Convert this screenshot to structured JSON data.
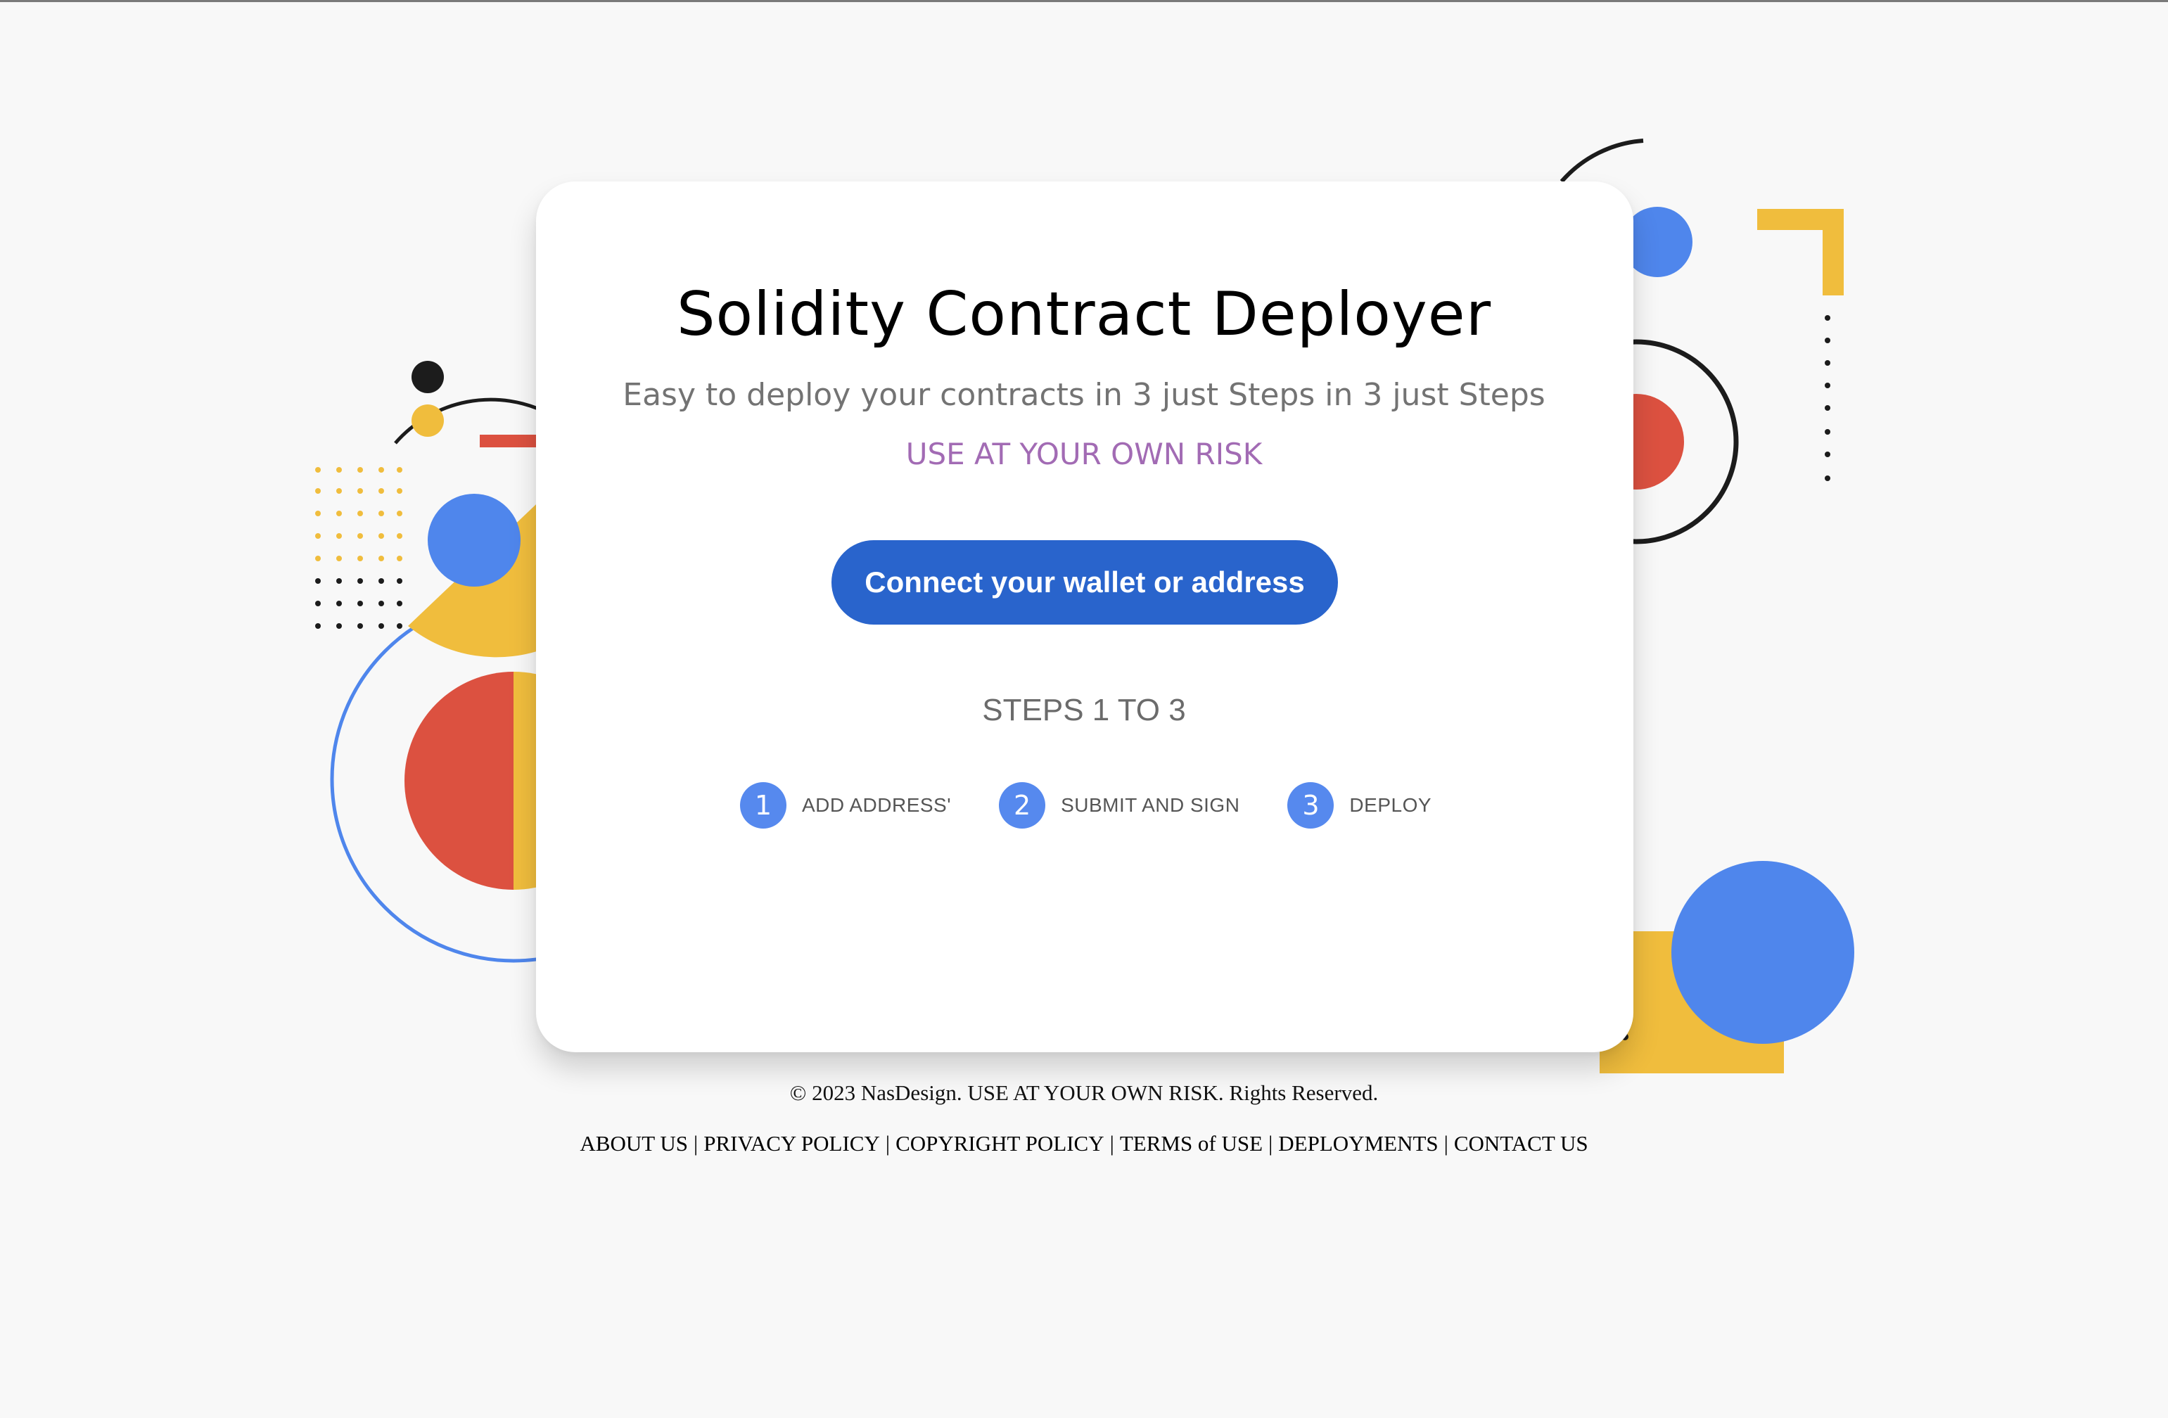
{
  "colors": {
    "background": "#f8f8f8",
    "card": "#ffffff",
    "accent_blue": "#2964cc",
    "step_blue": "#5689ee",
    "risk_purple": "#a26bb4",
    "deco_red": "#dc5140",
    "deco_yellow": "#f0bd3d",
    "deco_blue": "#4f86ec"
  },
  "header": {
    "title": "Solidity Contract Deployer",
    "subtitle": "Easy to deploy your contracts in 3 just Steps in 3 just Steps",
    "risk_notice": "USE AT YOUR OWN RISK"
  },
  "connect_button": {
    "label": "Connect your wallet or address"
  },
  "steps": {
    "heading": "STEPS 1 TO 3",
    "items": [
      {
        "number": "1",
        "label": "ADD ADDRESS'"
      },
      {
        "number": "2",
        "label": "SUBMIT AND SIGN"
      },
      {
        "number": "3",
        "label": "DEPLOY"
      }
    ]
  },
  "footer": {
    "copyright": "© 2023 NasDesign. USE AT YOUR OWN RISK. Rights Reserved.",
    "separator": "|",
    "links": [
      {
        "label": "ABOUT US"
      },
      {
        "label": "PRIVACY POLICY"
      },
      {
        "label": "COPYRIGHT POLICY"
      },
      {
        "label": "TERMS of USE"
      },
      {
        "label": "DEPLOYMENTS"
      },
      {
        "label": "CONTACT US"
      }
    ]
  }
}
